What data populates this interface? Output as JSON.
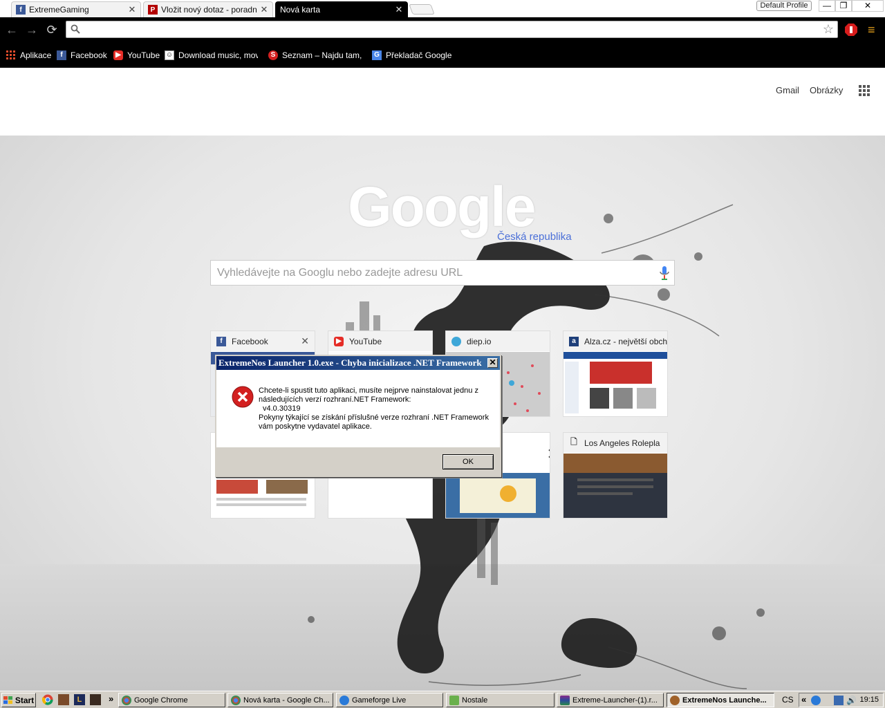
{
  "browser": {
    "tabs": [
      {
        "title": "ExtremeGaming",
        "icon": "facebook-icon"
      },
      {
        "title": "Vložit nový dotaz - poradna.n",
        "icon": "poradna-icon"
      },
      {
        "title": "Nová karta",
        "icon": "none",
        "active": true
      }
    ],
    "profile_label": "Default Profile",
    "omnibox_value": "",
    "bookmarks": [
      {
        "label": "Aplikace",
        "icon": "apps-grid-icon"
      },
      {
        "label": "Facebook",
        "icon": "facebook-icon"
      },
      {
        "label": "YouTube",
        "icon": "youtube-icon"
      },
      {
        "label": "Download music, movies",
        "icon": "download-icon"
      },
      {
        "label": "Seznam – Najdu tam, co",
        "icon": "seznam-icon"
      },
      {
        "label": "Překladač Google",
        "icon": "translate-icon"
      }
    ]
  },
  "ntp": {
    "gmail": "Gmail",
    "images": "Obrázky",
    "google_logo": "Google",
    "region": "Česká republika",
    "search_placeholder": "Vyhledávejte na Googlu nebo zadejte adresu URL",
    "tiles": [
      {
        "title": "Facebook",
        "icon": "facebook-icon"
      },
      {
        "title": "YouTube",
        "icon": "youtube-icon"
      },
      {
        "title": "diep.io",
        "icon": "diep-icon"
      },
      {
        "title": "Alza.cz - největší obch",
        "icon": "alza-icon"
      },
      {
        "title": "",
        "icon": ""
      },
      {
        "title": "",
        "icon": ""
      },
      {
        "title": "",
        "icon": ""
      },
      {
        "title": "Los Angeles Rolepla",
        "icon": "page-icon"
      }
    ]
  },
  "dialog": {
    "title": "ExtremeNos Launcher 1.0.exe - Chyba inicializace .NET Framework",
    "lines": [
      "Chcete-li spustit tuto aplikaci, musíte nejprve nainstalovat jednu z",
      "následujících verzí rozhraní.NET Framework:",
      "  v4.0.30319",
      "Pokyny týkající se získání příslušné verze rozhraní .NET Framework",
      "vám poskytne vydavatel aplikace."
    ],
    "ok_label": "OK"
  },
  "taskbar": {
    "start_label": "Start",
    "overflow": "»",
    "tasks": [
      {
        "label": "Google Chrome",
        "icon": "chrome-icon"
      },
      {
        "label": "Nová karta - Google Ch...",
        "icon": "chrome-icon"
      },
      {
        "label": "Gameforge Live",
        "icon": "gameforge-icon"
      },
      {
        "label": "Nostale",
        "icon": "nostale-icon"
      },
      {
        "label": "Extreme-Launcher-(1).r...",
        "icon": "winrar-icon"
      },
      {
        "label": "ExtremeNos Launche...",
        "icon": "launcher-icon",
        "active": true
      }
    ],
    "language": "CS",
    "tray_expand": "«",
    "clock": "19:15"
  },
  "colors": {
    "accent_blue": "#4a6fd8",
    "titlebar_start": "#0a246a",
    "error_red": "#d32020",
    "facebook_blue": "#3b5998",
    "youtube_red": "#e52d27"
  }
}
